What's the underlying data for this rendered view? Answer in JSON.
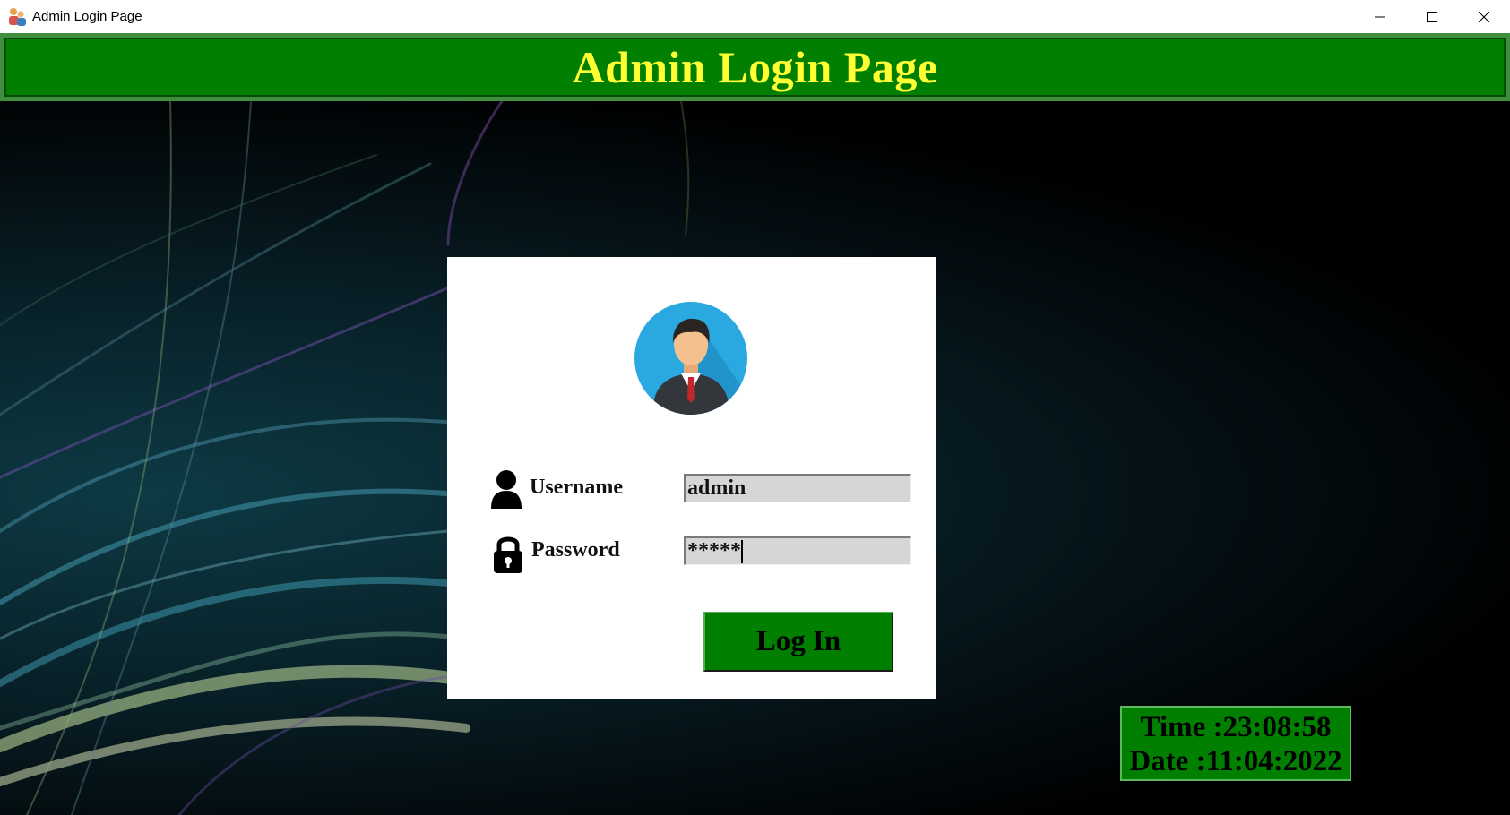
{
  "window": {
    "title": "Admin Login Page",
    "controls": [
      "minimize-icon",
      "maximize-icon",
      "close-icon"
    ]
  },
  "header": {
    "title": "Admin Login Page",
    "title_color": "#ffff33",
    "background_color": "#007f00"
  },
  "login": {
    "avatar_icon": "user-avatar-icon",
    "username_icon": "user-icon",
    "username_label": "Username",
    "username_value": "admin",
    "password_icon": "lock-icon",
    "password_label": "Password",
    "password_value": "*****",
    "login_button": "Log In"
  },
  "clock": {
    "time": "Time :23:08:58",
    "date": "Date :11:04:2022"
  }
}
